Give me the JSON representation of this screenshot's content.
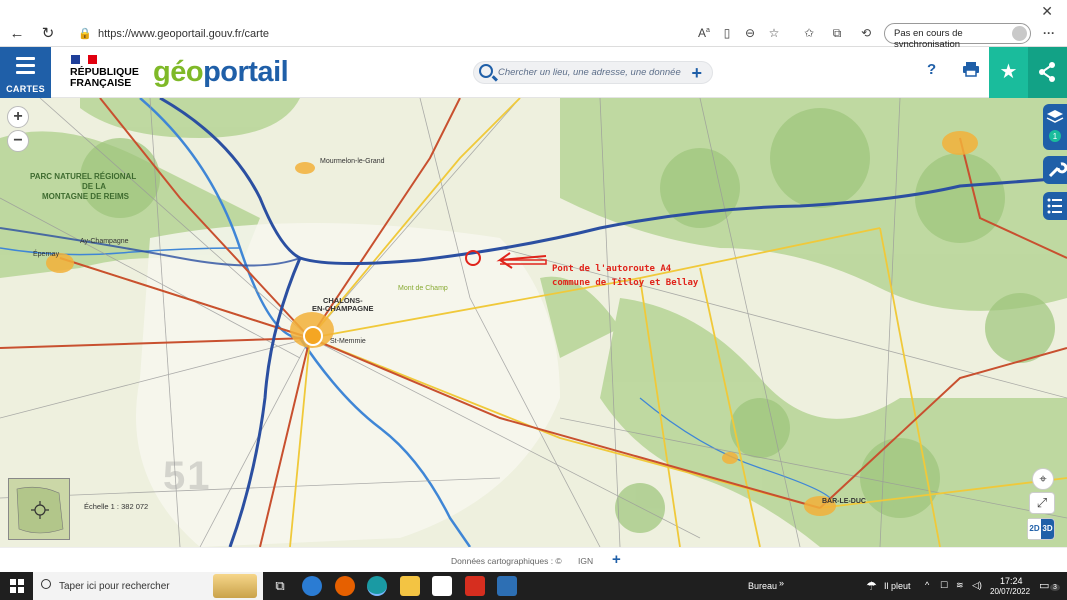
{
  "browser": {
    "url": "https://www.geoportail.gouv.fr/carte",
    "sync_label": "Pas en cours de synchronisation",
    "close_glyph": "✕"
  },
  "header": {
    "menu_label": "CARTES",
    "republique_line1": "RÉPUBLIQUE",
    "republique_line2": "FRANÇAISE",
    "logo_part1": "géo",
    "logo_part2": "portail",
    "search_placeholder": "Chercher un lieu, une adresse, une donnée",
    "help_label": "?"
  },
  "map": {
    "zoom_in": "+",
    "zoom_out": "−",
    "scale_label": "Échelle 1 : 382 072",
    "department_label": "51",
    "annotation_line1": "Pont de l'autoroute A4",
    "annotation_line2": "commune de Tilloy et Bellay",
    "places": {
      "chalons": "CHALONS-",
      "chalons2": "EN-CHAMPAGNE",
      "stmemmie": "St-Memmie",
      "mourmelon": "Mourmelon-le-Grand",
      "parc1": "PARC NATUREL RÉGIONAL",
      "parc2": "DE LA",
      "parc3": "MONTAGNE DE REIMS",
      "ay": "Ay-Champagne",
      "epernay": "Épernay",
      "barleduc": "BAR-LE-DUC",
      "mont": "Mont de Champ"
    },
    "toggle_2d": "2D",
    "toggle_3d": "3D"
  },
  "footer": {
    "attribution": "Données cartographiques : ©",
    "ign": "IGN",
    "plus": "+"
  },
  "taskbar": {
    "search_placeholder": "Taper ici pour rechercher",
    "bureau": "Bureau",
    "weather": "Il pleut",
    "time": "17:24",
    "date": "20/07/2022",
    "notif_count": "3"
  }
}
